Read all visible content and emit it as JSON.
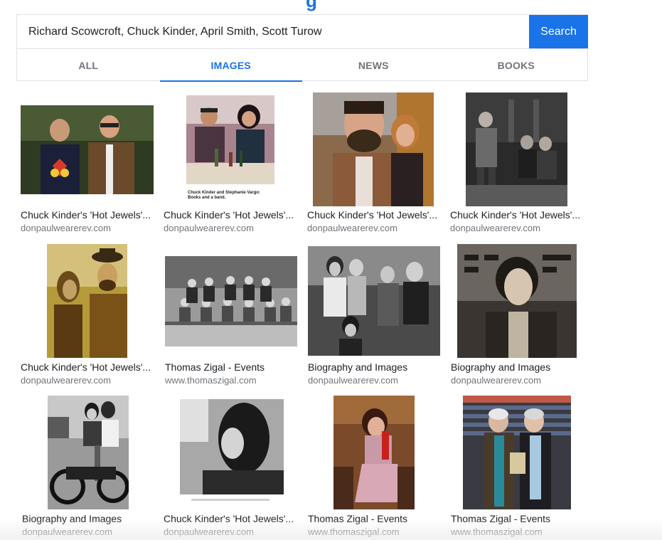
{
  "search": {
    "query": "Richard Scowcroft, Chuck Kinder, April Smith, Scott Turow",
    "button_label": "Search"
  },
  "logo_fragment": "g",
  "tabs": [
    {
      "label": "ALL",
      "active": false
    },
    {
      "label": "IMAGES",
      "active": true
    },
    {
      "label": "NEWS",
      "active": false
    },
    {
      "label": "BOOKS",
      "active": false
    }
  ],
  "results": [
    {
      "title": "Chuck Kinder's 'Hot Jewels'...",
      "source": "donpaulwearerev.com",
      "image": "two-men-portrait-photo"
    },
    {
      "title": "Chuck Kinder's 'Hot Jewels'...",
      "source": "donpaulwearerev.com",
      "image": "couple-at-table-photo",
      "caption": "Chuck Kinder and Stephanie Vargo: Books and a band."
    },
    {
      "title": "Chuck Kinder's 'Hot Jewels'...",
      "source": "donpaulwearerev.com",
      "image": "bearded-man-woman-photo"
    },
    {
      "title": "Chuck Kinder's 'Hot Jewels'...",
      "source": "donpaulwearerev.com",
      "image": "group-on-porch-photo"
    },
    {
      "title": "Chuck Kinder's 'Hot Jewels'...",
      "source": "donpaulwearerev.com",
      "image": "couple-sepia-photo"
    },
    {
      "title": "Thomas Zigal - Events",
      "source": "www.thomaszigal.com",
      "image": "group-bench-photo"
    },
    {
      "title": "Biography and Images",
      "source": "donpaulwearerev.com",
      "image": "group-outdoors-photo"
    },
    {
      "title": "Biography and Images",
      "source": "donpaulwearerev.com",
      "image": "young-man-portrait-photo"
    },
    {
      "title": "Biography and Images",
      "source": "donpaulwearerev.com",
      "image": "couple-motorcycle-photo"
    },
    {
      "title": "Chuck Kinder's 'Hot Jewels'...",
      "source": "donpaulwearerev.com",
      "image": "long-hair-man-photo"
    },
    {
      "title": "Thomas Zigal - Events",
      "source": "www.thomaszigal.com",
      "image": "woman-on-phone-photo"
    },
    {
      "title": "Thomas Zigal - Events",
      "source": "www.thomaszigal.com",
      "image": "two-men-bookstore-photo"
    }
  ]
}
